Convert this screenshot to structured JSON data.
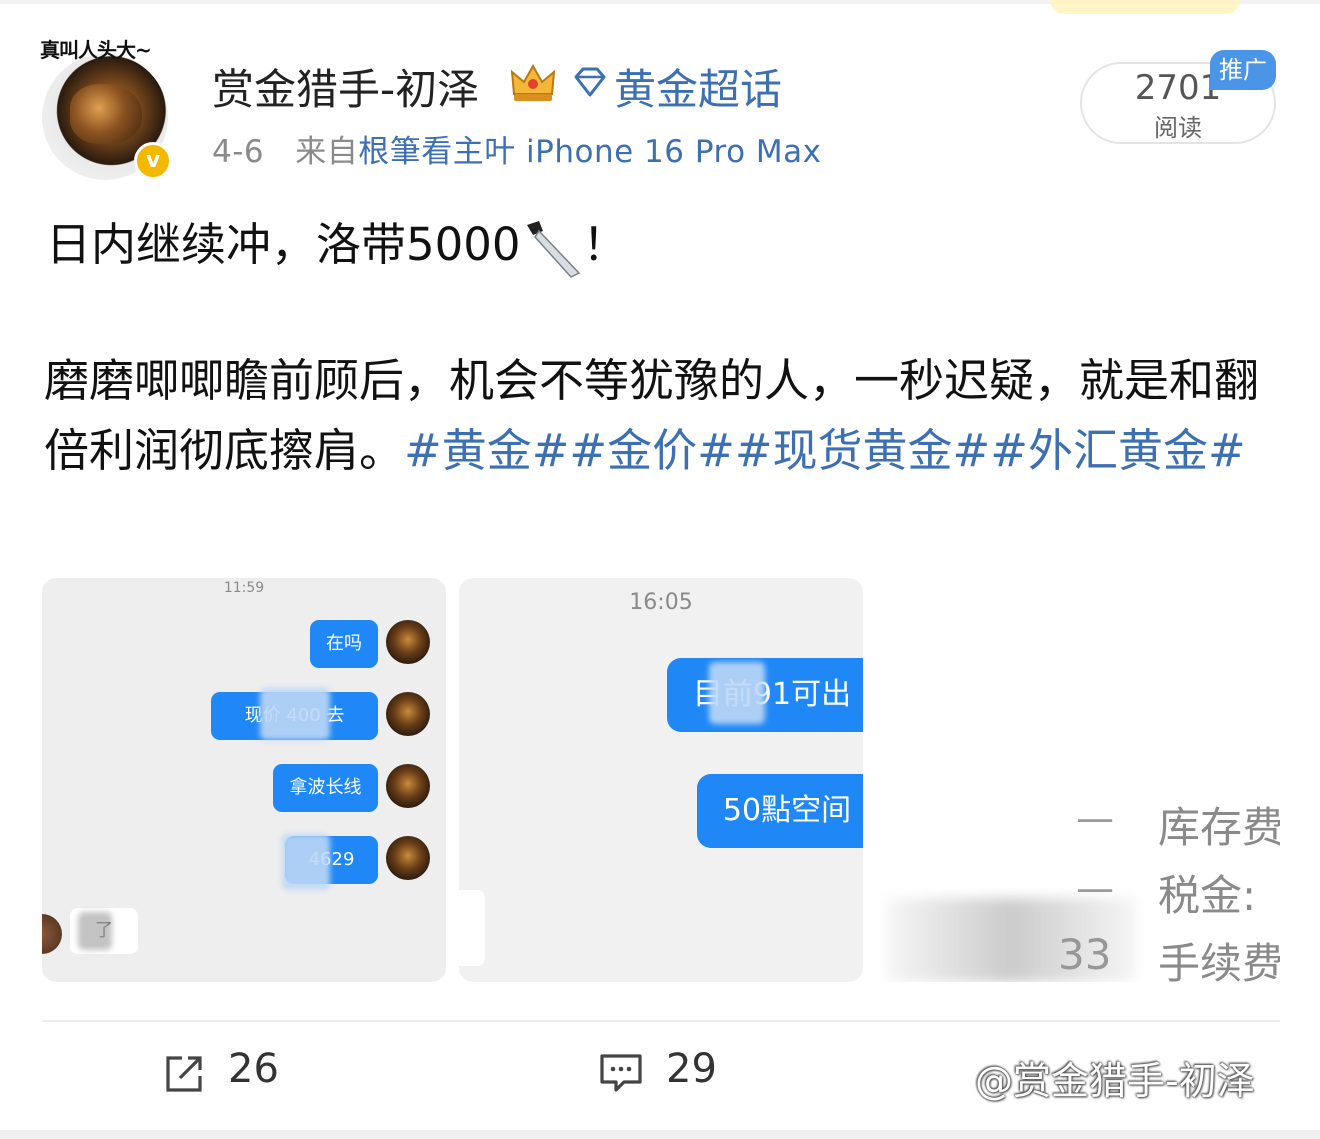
{
  "post": {
    "avatar_caption": "真叫人头大~",
    "username": "赏金猎手-初泽",
    "topic_tag": "黄金超话",
    "date": "4-6",
    "source_prefix": "来自",
    "source_device": "根筆看主叶 iPhone 16 Pro Max",
    "read_count": "2701",
    "read_label": "阅读",
    "promo_badge": "推广",
    "line1": "日内继续冲，洛带5000",
    "line1_end": "！",
    "para_text": "磨磨唧唧瞻前顾后，机会不等犹豫的人，一秒迟疑，就是和翻倍利润彻底擦肩。",
    "para_tags": "#黄金##金价##现货黄金##外汇黄金#"
  },
  "images": {
    "chat1": {
      "time": "11:59",
      "bubbles": [
        "在吗",
        "现价  400  去",
        "拿波长线",
        "  4629"
      ],
      "reply": "  了"
    },
    "chat2": {
      "time": "16:05",
      "bubbles": [
        "目前91可出",
        "50點空间"
      ]
    },
    "fees": {
      "rows": [
        "库存费",
        "税金:",
        "手续费"
      ],
      "left_value": "33"
    }
  },
  "actions": {
    "share_count": "26",
    "comment_count": "29",
    "watermark": "@赏金猎手-初泽"
  }
}
